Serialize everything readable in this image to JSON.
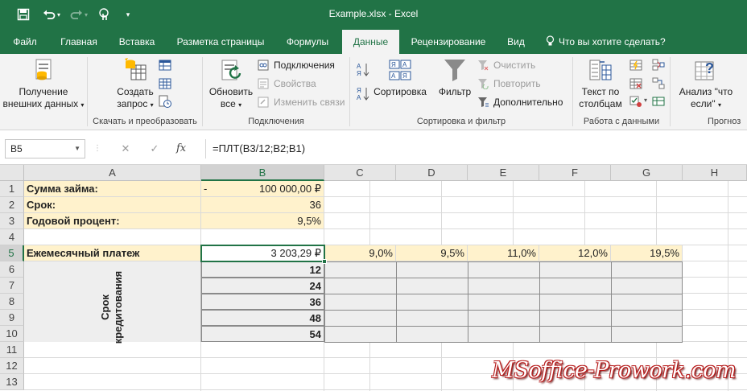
{
  "window": {
    "title": "Example.xlsx - Excel"
  },
  "quick_access": {
    "save_icon": "save-icon",
    "undo_icon": "undo-icon",
    "redo_icon": "redo-icon",
    "touch_icon": "touch-mode-icon",
    "customize_icon": "customize-qat-icon"
  },
  "tabs": [
    "Файл",
    "Главная",
    "Вставка",
    "Разметка страницы",
    "Формулы",
    "Данные",
    "Рецензирование",
    "Вид"
  ],
  "active_tab": "Данные",
  "tell_me": "Что вы хотите сделать?",
  "ribbon": {
    "get_external": {
      "line1": "Получение",
      "line2": "внешних данных"
    },
    "new_query": {
      "line1": "Создать",
      "line2": "запрос"
    },
    "group_transform": "Скачать и преобразовать",
    "refresh": {
      "line1": "Обновить",
      "line2": "все"
    },
    "connections": "Подключения",
    "properties": "Свойства",
    "edit_links": "Изменить связи",
    "group_connections": "Подключения",
    "sort": "Сортировка",
    "filter": "Фильтр",
    "clear": "Очистить",
    "reapply": "Повторить",
    "advanced": "Дополнительно",
    "group_sort": "Сортировка и фильтр",
    "text_to_columns": {
      "line1": "Текст по",
      "line2": "столбцам"
    },
    "group_data_tools": "Работа с данными",
    "what_if": {
      "line1": "Анализ \"что",
      "line2": "если\""
    },
    "group_forecast": "Прогноз"
  },
  "formula_bar": {
    "name_box": "B5",
    "cancel": "✕",
    "enter": "✓",
    "fx": "fx",
    "formula": "=ПЛТ(B3/12;B2;B1)"
  },
  "columns": [
    "A",
    "B",
    "C",
    "D",
    "E",
    "F",
    "G",
    "H"
  ],
  "rows": [
    "1",
    "2",
    "3",
    "4",
    "5",
    "6",
    "7",
    "8",
    "9",
    "10",
    "11",
    "12",
    "13"
  ],
  "cells": {
    "A1": "Сумма займа:",
    "B1_dash": "-",
    "B1": "100 000,00 ₽",
    "A2": "Срок:",
    "B2": "36",
    "A3": "Годовой процент:",
    "B3": "9,5%",
    "A5": "Ежемесячный платеж",
    "B5": "3 203,29 ₽",
    "C5": "9,0%",
    "D5": "9,5%",
    "E5": "11,0%",
    "F5": "12,0%",
    "G5": "19,5%",
    "B6": "12",
    "B7": "24",
    "B8": "36",
    "B9": "48",
    "B10": "54",
    "A6_10_line1": "Срок",
    "A6_10_line2": "кредитования"
  },
  "watermark": "MSoffice-Prowork.com",
  "colors": {
    "excel_green": "#217346",
    "input_yellow": "#fff2cc",
    "table_gray": "#eeeeee"
  }
}
